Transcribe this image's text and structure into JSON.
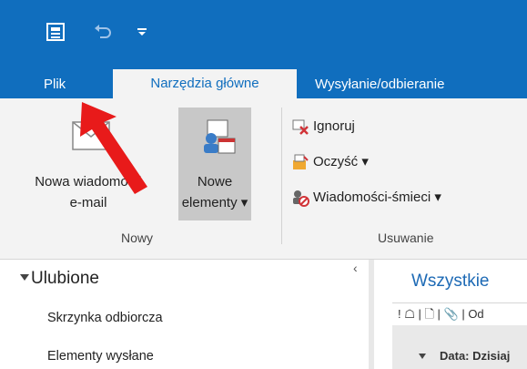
{
  "tabs": {
    "file": "Plik",
    "home": "Narzędzia główne",
    "send_receive": "Wysyłanie/odbieranie"
  },
  "ribbon": {
    "new_email": {
      "line1": "Nowa wiadomość",
      "line2": "e-mail"
    },
    "new_items": {
      "line1": "Nowe",
      "line2": "elementy ▾"
    },
    "group_new": "Nowy",
    "ignore": "Ignoruj",
    "clean_up": "Oczyść ▾",
    "junk": "Wiadomości-śmieci ▾",
    "group_delete": "Usuwanie"
  },
  "nav": {
    "favorites": "Ulubione",
    "folders": [
      "Skrzynka odbiorcza",
      "Elementy wysłane"
    ]
  },
  "list": {
    "filter": "Wszystkie",
    "columns_header": "! ☖ | 🗋 | 📎 | Od",
    "group_header": "Data: Dzisiaj"
  },
  "colors": {
    "accent": "#106ebe",
    "arrow": "#e81a1a"
  }
}
